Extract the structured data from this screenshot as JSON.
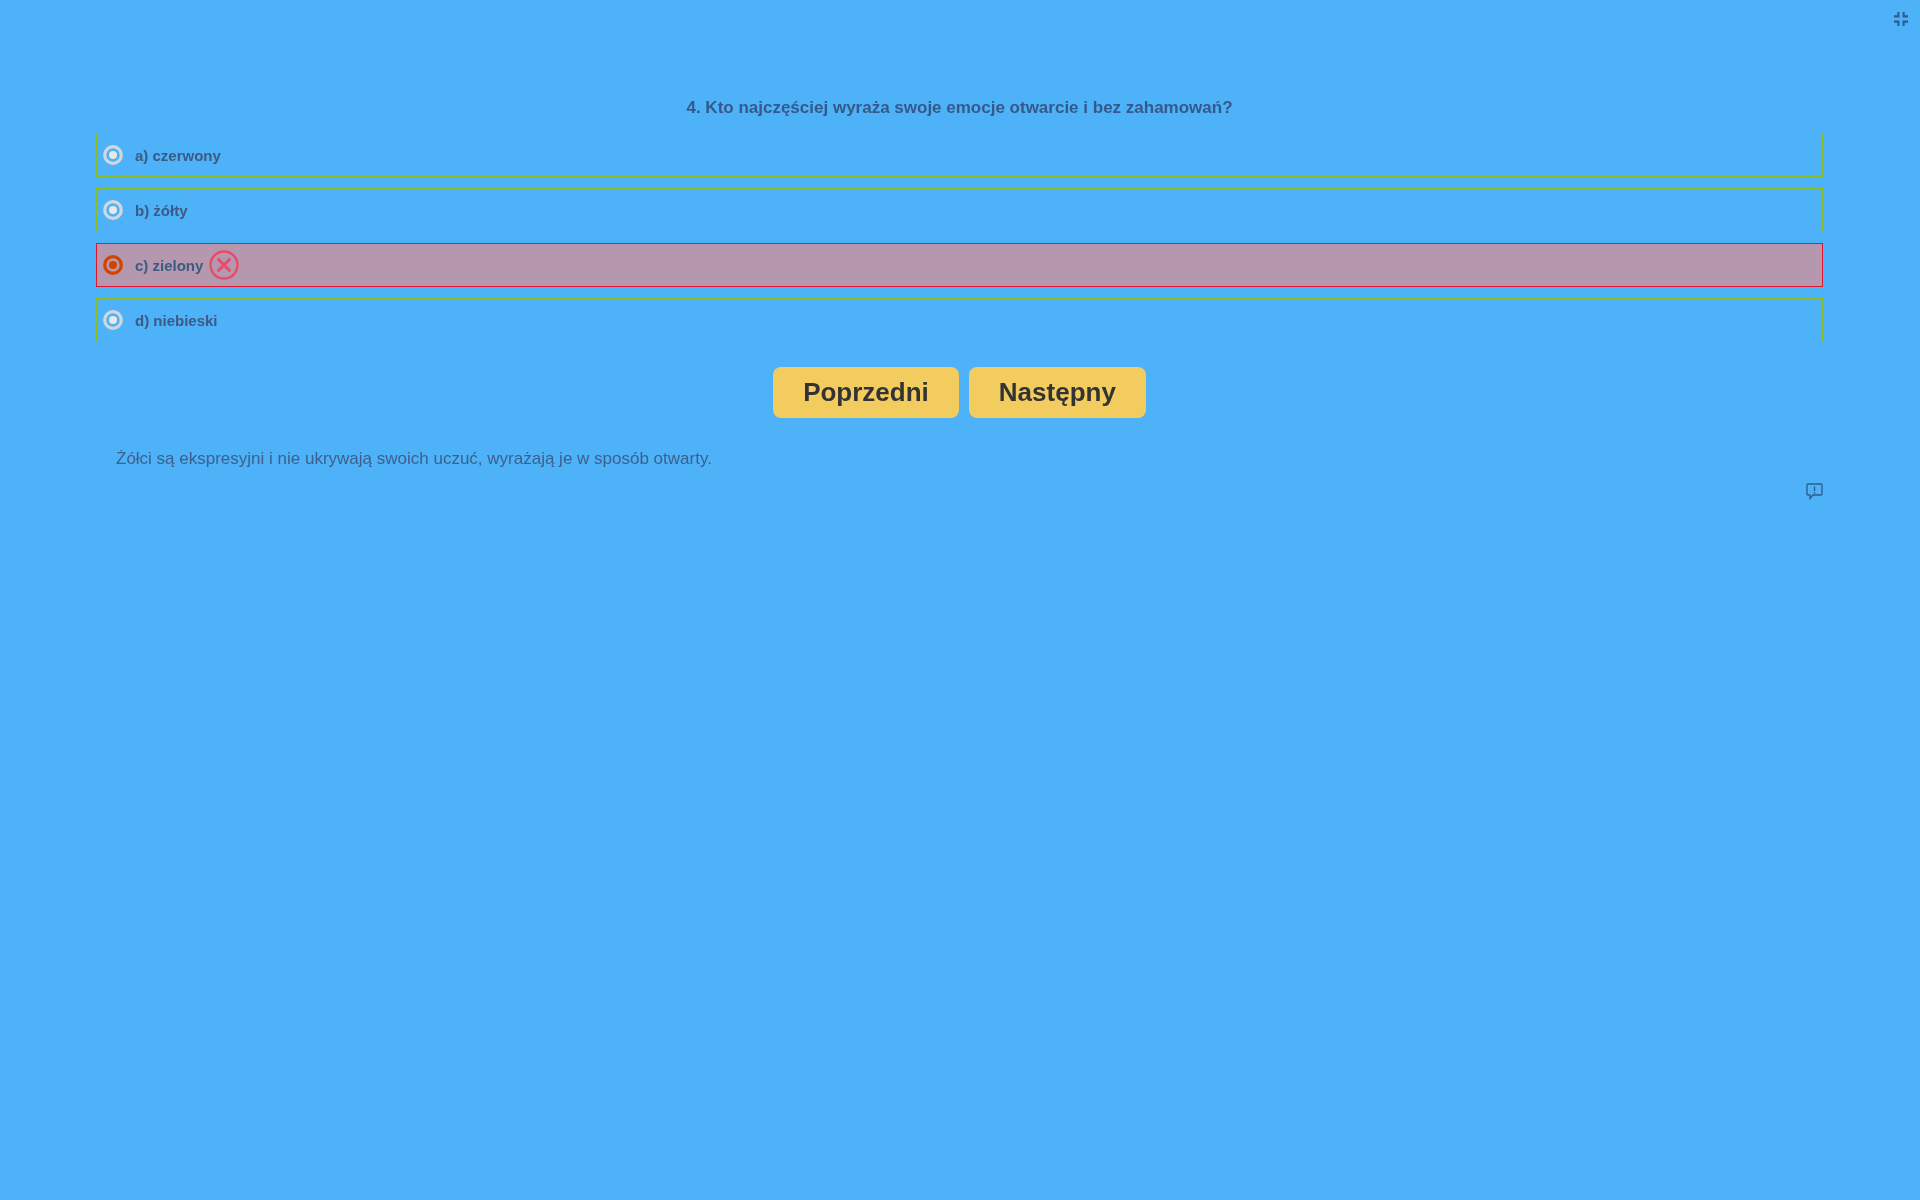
{
  "question": "4. Kto najczęściej wyraża swoje emocje otwarcie i bez zahamowań?",
  "options": [
    {
      "label": "a) czerwony",
      "selected": false,
      "wrong": false
    },
    {
      "label": "b) żółty",
      "selected": false,
      "wrong": false
    },
    {
      "label": "c) zielony",
      "selected": true,
      "wrong": true
    },
    {
      "label": "d) niebieski",
      "selected": false,
      "wrong": false
    }
  ],
  "buttons": [
    "Poprzedni",
    "Następny"
  ],
  "explanation": "Żółci są ekspresyjni i nie ukrywają swoich uczuć, wyrażają je w sposób otwarty."
}
